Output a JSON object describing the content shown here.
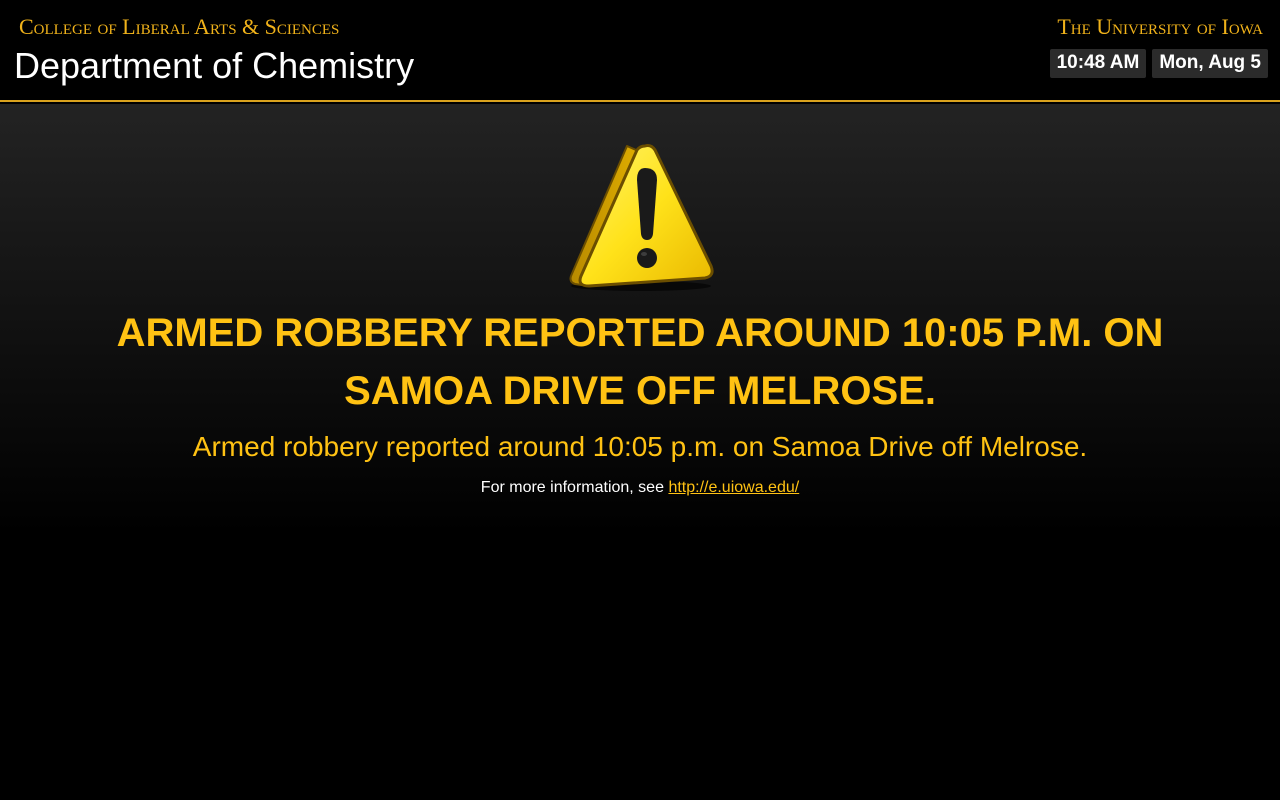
{
  "header": {
    "college": "College of Liberal Arts & Sciences",
    "department": "Department of Chemistry",
    "university": "The University of Iowa",
    "time": "10:48 AM",
    "date": "Mon, Aug 5"
  },
  "alert": {
    "icon": "warning-icon",
    "headline": "ARMED ROBBERY REPORTED AROUND 10:05 P.M. ON SAMOA DRIVE OFF MELROSE.",
    "message": "Armed robbery reported around 10:05 p.m. on Samoa Drive off Melrose.",
    "more_info_prefix": "For more information, see",
    "link_text": "http://e.uiowa.edu/"
  },
  "colors": {
    "accent": "#ffc213",
    "gold_rule": "#d9a21e",
    "background": "#000000"
  }
}
